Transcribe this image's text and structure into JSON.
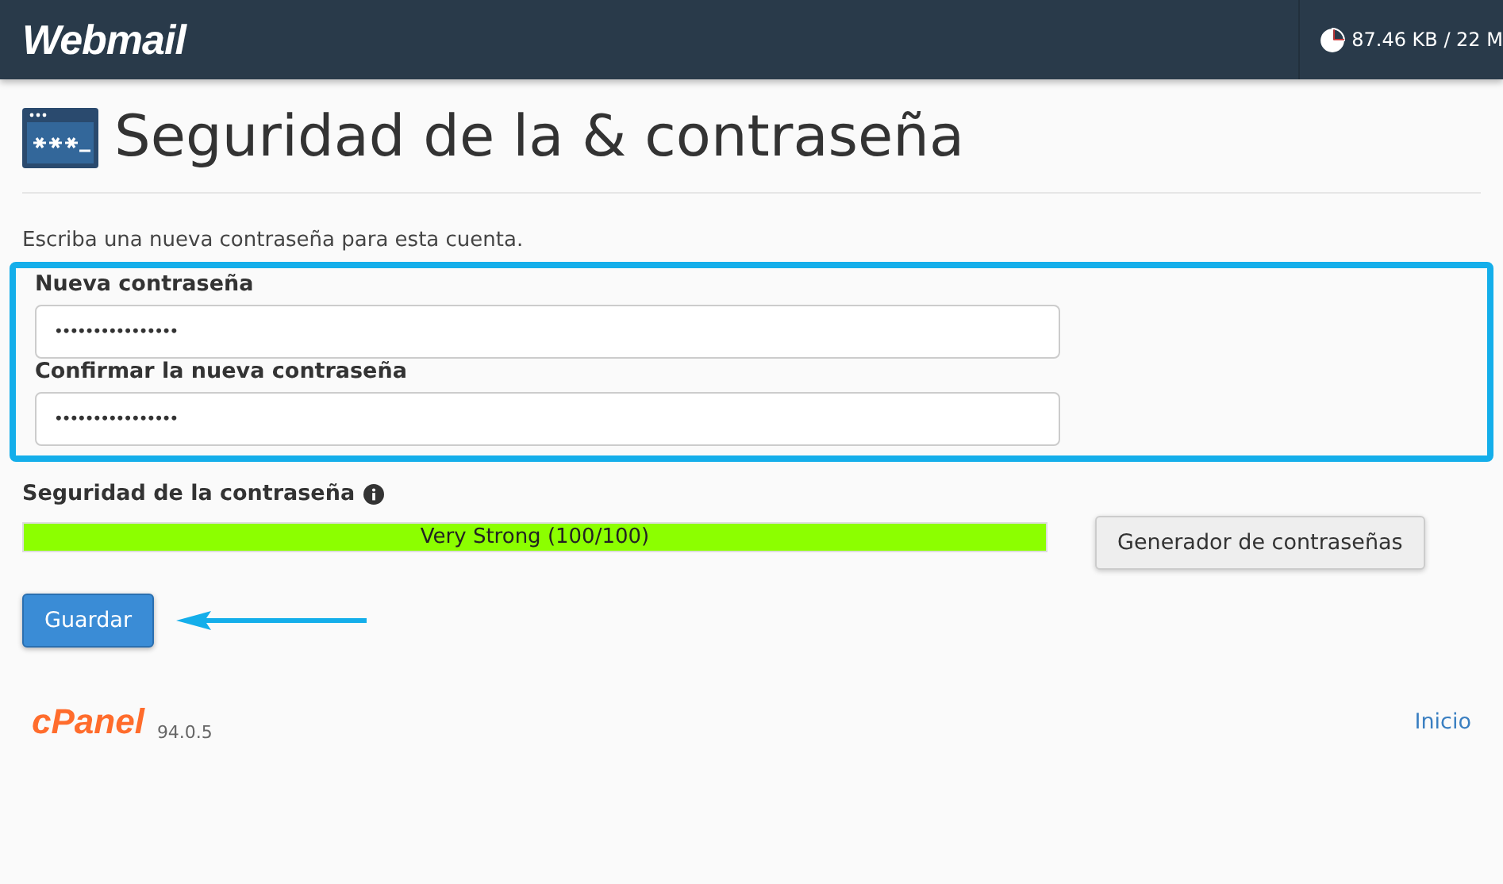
{
  "header": {
    "logo": "Webmail",
    "quota": "87.46 KB / 22 M"
  },
  "page": {
    "title": "Seguridad de la & contraseña",
    "intro": "Escriba una nueva contraseña para esta cuenta."
  },
  "fields": [
    {
      "label": "Nueva contraseña",
      "value": "••••••••••••••••"
    },
    {
      "label": "Confirmar la nueva contraseña",
      "value": "••••••••••••••••"
    }
  ],
  "strength": {
    "label": "Seguridad de la contraseña",
    "reading": "Very Strong (100/100)",
    "level": 1
  },
  "buttons": {
    "generator": "Generador de contraseñas",
    "save": "Guardar"
  },
  "footer": {
    "logo": "cPanel",
    "version": "94.0.5",
    "link": "Inicio"
  }
}
